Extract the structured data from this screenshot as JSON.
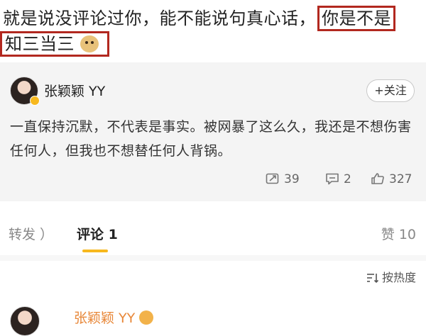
{
  "top_comment": {
    "line1_text": "就是说没评论过你，能不能说句真心话，",
    "line1_highlight": "你是不是",
    "line2_highlight": "知三当三",
    "emoji_icon": "doge-icon",
    "highlight_color": "#b2281f"
  },
  "post": {
    "author": "张颖颖 YY",
    "follow_label": "+关注",
    "text": "一直保持沉默，不代表是事实。被网暴了这么久，我还是不想伤害任何人，但我也不想替任何人背锅。",
    "actions": {
      "repost_count": "39",
      "comment_count": "2",
      "like_count": "327"
    }
  },
  "tabs": {
    "repost_label": "转发 ）",
    "comments_label": "评论 1",
    "likes_label": "赞 10",
    "accent_color": "#f7b81e"
  },
  "sort": {
    "label": "按热度"
  },
  "comment": {
    "author": "张颖颖 YY"
  }
}
